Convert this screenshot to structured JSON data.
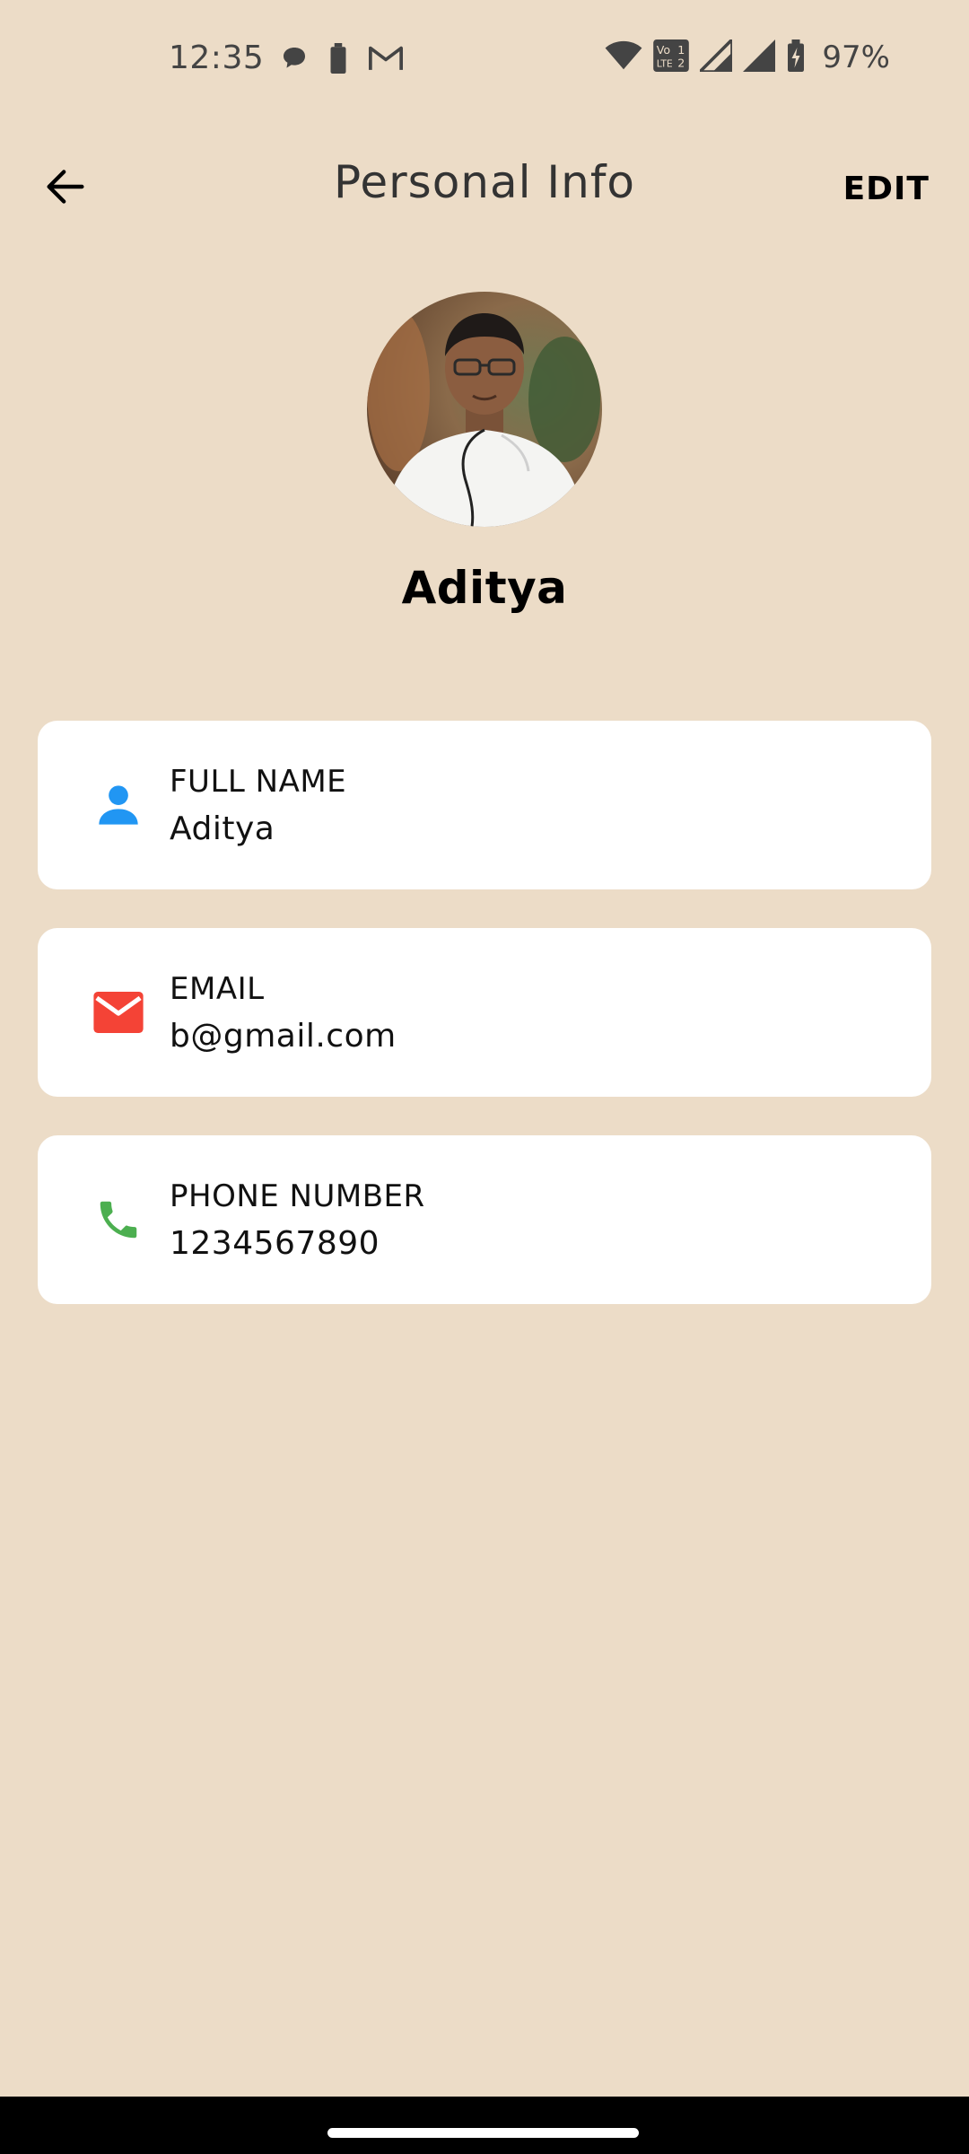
{
  "status_bar": {
    "time": "12:35",
    "battery_percent": "97%",
    "left_icons": [
      "chat-bubble-icon",
      "battery-saver-icon",
      "gmail-icon"
    ],
    "right_icons": [
      "wifi-icon",
      "volte-icon",
      "signal-icon",
      "signal-icon",
      "battery-charging-icon"
    ]
  },
  "app_bar": {
    "title": "Personal Info",
    "edit_label": "EDIT",
    "back_icon": "arrow-back-icon"
  },
  "profile": {
    "name": "Aditya"
  },
  "cards": [
    {
      "label": "FULL NAME",
      "value": "Aditya",
      "icon": "person-icon",
      "color": "#2196f3"
    },
    {
      "label": "EMAIL",
      "value": "b@gmail.com",
      "icon": "email-icon",
      "color": "#f44336"
    },
    {
      "label": "PHONE NUMBER",
      "value": "1234567890",
      "icon": "phone-icon",
      "color": "#4caf50"
    }
  ],
  "colors": {
    "background": "#ecdcc7",
    "card": "#ffffff",
    "nav_bar": "#000000"
  }
}
